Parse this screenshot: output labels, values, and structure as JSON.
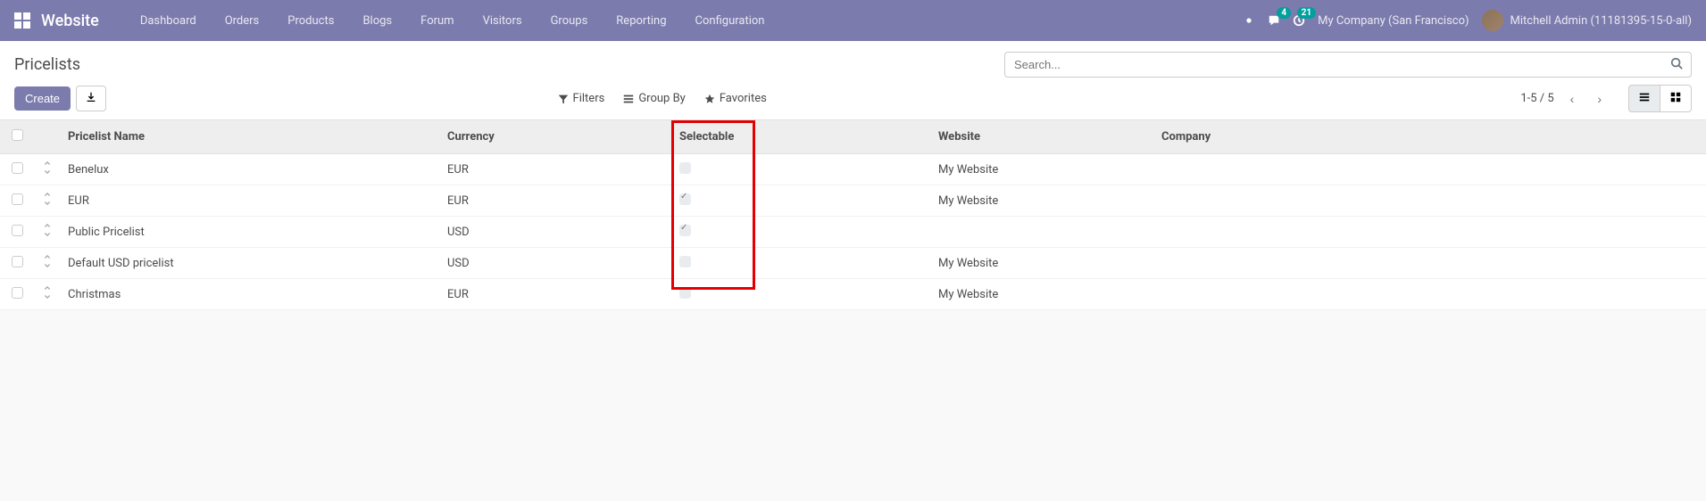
{
  "nav": {
    "brand": "Website",
    "items": [
      "Dashboard",
      "Orders",
      "Products",
      "Blogs",
      "Forum",
      "Visitors",
      "Groups",
      "Reporting",
      "Configuration"
    ],
    "messages_badge": "4",
    "activities_badge": "21",
    "company": "My Company (San Francisco)",
    "user": "Mitchell Admin (11181395-15-0-all)"
  },
  "breadcrumb": "Pricelists",
  "search": {
    "placeholder": "Search..."
  },
  "buttons": {
    "create": "Create"
  },
  "search_options": {
    "filters": "Filters",
    "groupby": "Group By",
    "favorites": "Favorites"
  },
  "pager": "1-5 / 5",
  "columns": {
    "name": "Pricelist Name",
    "currency": "Currency",
    "selectable": "Selectable",
    "website": "Website",
    "company": "Company"
  },
  "rows": [
    {
      "name": "Benelux",
      "currency": "EUR",
      "selectable": false,
      "website": "My Website",
      "company": ""
    },
    {
      "name": "EUR",
      "currency": "EUR",
      "selectable": true,
      "website": "My Website",
      "company": ""
    },
    {
      "name": "Public Pricelist",
      "currency": "USD",
      "selectable": true,
      "website": "",
      "company": ""
    },
    {
      "name": "Default USD pricelist",
      "currency": "USD",
      "selectable": false,
      "website": "My Website",
      "company": ""
    },
    {
      "name": "Christmas",
      "currency": "EUR",
      "selectable": false,
      "website": "My Website",
      "company": ""
    }
  ]
}
